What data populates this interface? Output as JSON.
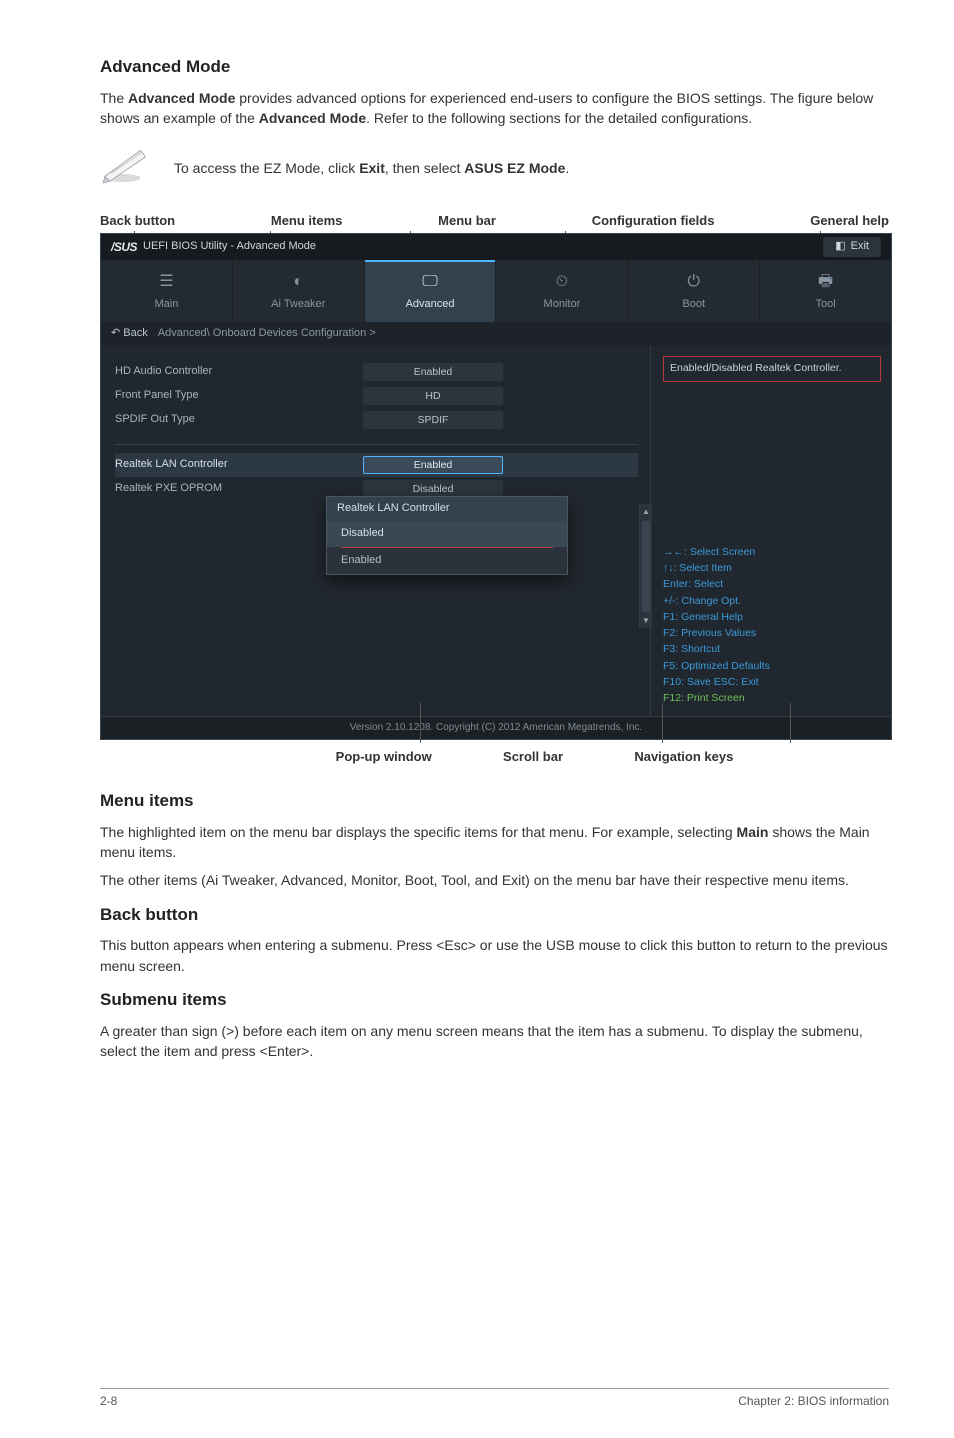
{
  "sections": {
    "advanced_mode": {
      "heading": "Advanced Mode",
      "paragraph_parts": [
        "The ",
        "Advanced Mode",
        " provides advanced options for experienced end-users to configure the BIOS settings. The figure below shows an example of the ",
        "Advanced Mode",
        ". Refer to the following sections for the detailed configurations."
      ],
      "note_parts": [
        "To access the EZ Mode, click ",
        "Exit",
        ", then select ",
        "ASUS EZ Mode",
        "."
      ]
    },
    "menu_items": {
      "heading": "Menu items",
      "p1_parts": [
        "The highlighted item on the menu bar displays the specific items for that menu. For example, selecting ",
        "Main",
        " shows the Main menu items."
      ],
      "p2": "The other items (Ai Tweaker, Advanced, Monitor, Boot, Tool, and Exit) on the menu bar have their respective menu items."
    },
    "back_button": {
      "heading": "Back button",
      "p": "This button appears when entering a submenu. Press <Esc> or use the USB mouse to click this button to return to the previous menu screen."
    },
    "submenu_items": {
      "heading": "Submenu items",
      "p": "A greater than sign (>) before each item on any menu screen means that the item has a submenu. To display the submenu, select the item and press <Enter>."
    }
  },
  "labels_top": {
    "back_button": "Back button",
    "menu_items": "Menu items",
    "menu_bar": "Menu bar",
    "config_fields": "Configuration fields",
    "general_help": "General help"
  },
  "labels_bottom": {
    "popup": "Pop-up window",
    "scroll": "Scroll bar",
    "nav": "Navigation keys"
  },
  "bios": {
    "logo": "/SUS",
    "title": "UEFI BIOS Utility - Advanced Mode",
    "exit": "Exit",
    "tabs": [
      {
        "icon": "list-icon",
        "glyph": "☰",
        "label": "Main"
      },
      {
        "icon": "tweaker-icon",
        "glyph": "◐",
        "label": "Ai Tweaker"
      },
      {
        "icon": "monitor-icon",
        "glyph": "🖵",
        "label": "Advanced",
        "active": true
      },
      {
        "icon": "gauge-icon",
        "glyph": "⏲",
        "label": "Monitor"
      },
      {
        "icon": "power-icon",
        "glyph": "⏻",
        "label": "Boot"
      },
      {
        "icon": "tool-icon",
        "glyph": "🖶",
        "label": "Tool"
      }
    ],
    "crumb_back": "Back",
    "crumb_path": "Advanced\\ Onboard Devices Configuration >",
    "rows": [
      {
        "label": "HD Audio Controller",
        "value": "Enabled"
      },
      {
        "label": "Front Panel Type",
        "value": "HD"
      },
      {
        "label": "SPDIF Out Type",
        "value": "SPDIF"
      }
    ],
    "selected_row": {
      "label": "Realtek LAN Controller",
      "value": "Enabled"
    },
    "extra_row": {
      "label": "Realtek PXE OPROM",
      "value": "Disabled"
    },
    "popup": {
      "title": "Realtek LAN Controller",
      "items": [
        "Disabled",
        "Enabled"
      ]
    },
    "hint": "Enabled/Disabled Realtek Controller.",
    "keys": [
      "→←: Select Screen",
      "↑↓: Select Item",
      "Enter: Select",
      "+/-: Change Opt.",
      "F1: General Help",
      "F2: Previous Values",
      "F3: Shortcut",
      "F5: Optimized Defaults",
      "F10: Save   ESC: Exit",
      "F12: Print Screen"
    ],
    "footer": "Version 2.10.1208.  Copyright (C) 2012 American Megatrends, Inc."
  },
  "page_footer": {
    "left": "2-8",
    "right": "Chapter 2: BIOS information"
  }
}
